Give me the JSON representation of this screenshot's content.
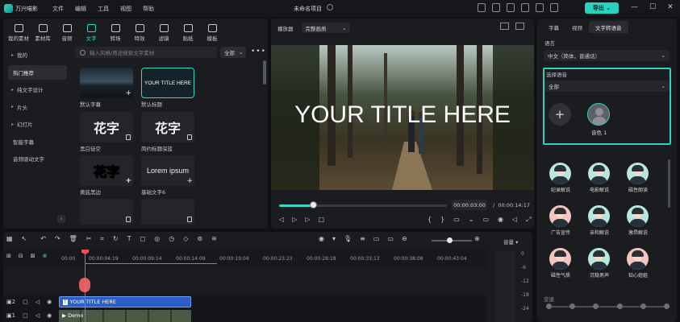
{
  "titlebar": {
    "app_name": "万兴喵影",
    "menus": [
      "文件",
      "编辑",
      "工具",
      "视图",
      "帮助"
    ],
    "project_title": "未命名项目",
    "export_label": "导出"
  },
  "tool_tabs": [
    {
      "label": "我的素材",
      "icon": "folder-icon"
    },
    {
      "label": "素材库",
      "icon": "media-library-icon"
    },
    {
      "label": "音频",
      "icon": "music-icon"
    },
    {
      "label": "文字",
      "icon": "text-icon",
      "active": true
    },
    {
      "label": "转场",
      "icon": "transition-icon"
    },
    {
      "label": "特效",
      "icon": "effects-icon"
    },
    {
      "label": "滤镜",
      "icon": "filter-icon"
    },
    {
      "label": "贴纸",
      "icon": "sticker-icon"
    },
    {
      "label": "模板",
      "icon": "template-icon"
    }
  ],
  "sidebar": {
    "items": [
      {
        "label": "我的",
        "caret": true
      },
      {
        "label": "热门推荐",
        "active": true
      },
      {
        "label": "纯文字设计",
        "caret": true
      },
      {
        "label": "片头",
        "caret": true
      },
      {
        "label": "幻灯片",
        "caret": true
      },
      {
        "label": "智能字幕",
        "caret": false
      },
      {
        "label": "音频驱动文字",
        "caret": false
      }
    ]
  },
  "search": {
    "placeholder": "输入风格/用途搜索文字素材",
    "filter": "全部"
  },
  "thumbnails": [
    {
      "label": "默认字幕",
      "preview": ""
    },
    {
      "label": "默认标题",
      "preview": "YOUR TITLE HERE"
    },
    {
      "label": "黑白徒空",
      "preview": "花字"
    },
    {
      "label": "简约标题深蓝",
      "preview": "花字"
    },
    {
      "label": "黄底黑边",
      "preview": "花字"
    },
    {
      "label": "基础文字6",
      "preview": "Lorem ipsum"
    }
  ],
  "preview": {
    "player_label": "播放器",
    "quality": "完整画质",
    "video_title": "YOUR TITLE HERE",
    "current_time": "00:00:03:00",
    "total_time": "00:00:14:17",
    "progress_fraction": 0.2
  },
  "right_panel": {
    "tabs": [
      "字幕",
      "视频",
      "文字转语音"
    ],
    "language_label": "语言",
    "language_value": "中文（简体，普通话）",
    "select_voice_label": "选择语音",
    "voice_filter": "全部",
    "selected_voice": "音色 1",
    "voices": [
      "纪录解说",
      "电影解说",
      "磁性朗读",
      "广告宣传",
      "亲和解说",
      "激昂解说",
      "磁性气质",
      "沉稳男声",
      "知心姐姐"
    ],
    "speed_label": "变速",
    "slider_steps": 6
  },
  "timeline": {
    "ruler": [
      "00:00",
      "00:00:04:19",
      "00:00:09:14",
      "00:00:14:09",
      "00:00:19:04",
      "00:00:23:23",
      "00:00:28:18",
      "00:00:33:13",
      "00:00:38:08",
      "00:00:43:04"
    ],
    "text_clip": "YOUR TITLE HERE",
    "video_clip": "Demo",
    "volume_label": "音量",
    "volume_scale": [
      "0",
      "-6",
      "-12",
      "-18",
      "-24"
    ],
    "track_numbers": [
      "2",
      "1"
    ]
  }
}
